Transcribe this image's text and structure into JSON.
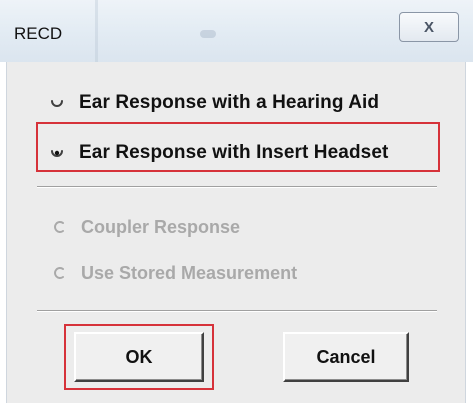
{
  "window": {
    "title": "RECD",
    "close_glyph": "X"
  },
  "options": {
    "hearing_aid": "Ear Response with a Hearing Aid",
    "insert_headset": "Ear Response with Insert Headset",
    "coupler": "Coupler Response",
    "stored": "Use Stored Measurement"
  },
  "selected_option": "insert_headset",
  "buttons": {
    "ok": "OK",
    "cancel": "Cancel"
  },
  "colors": {
    "highlight": "#d6323a",
    "disabled_text": "#a9a9a9"
  }
}
